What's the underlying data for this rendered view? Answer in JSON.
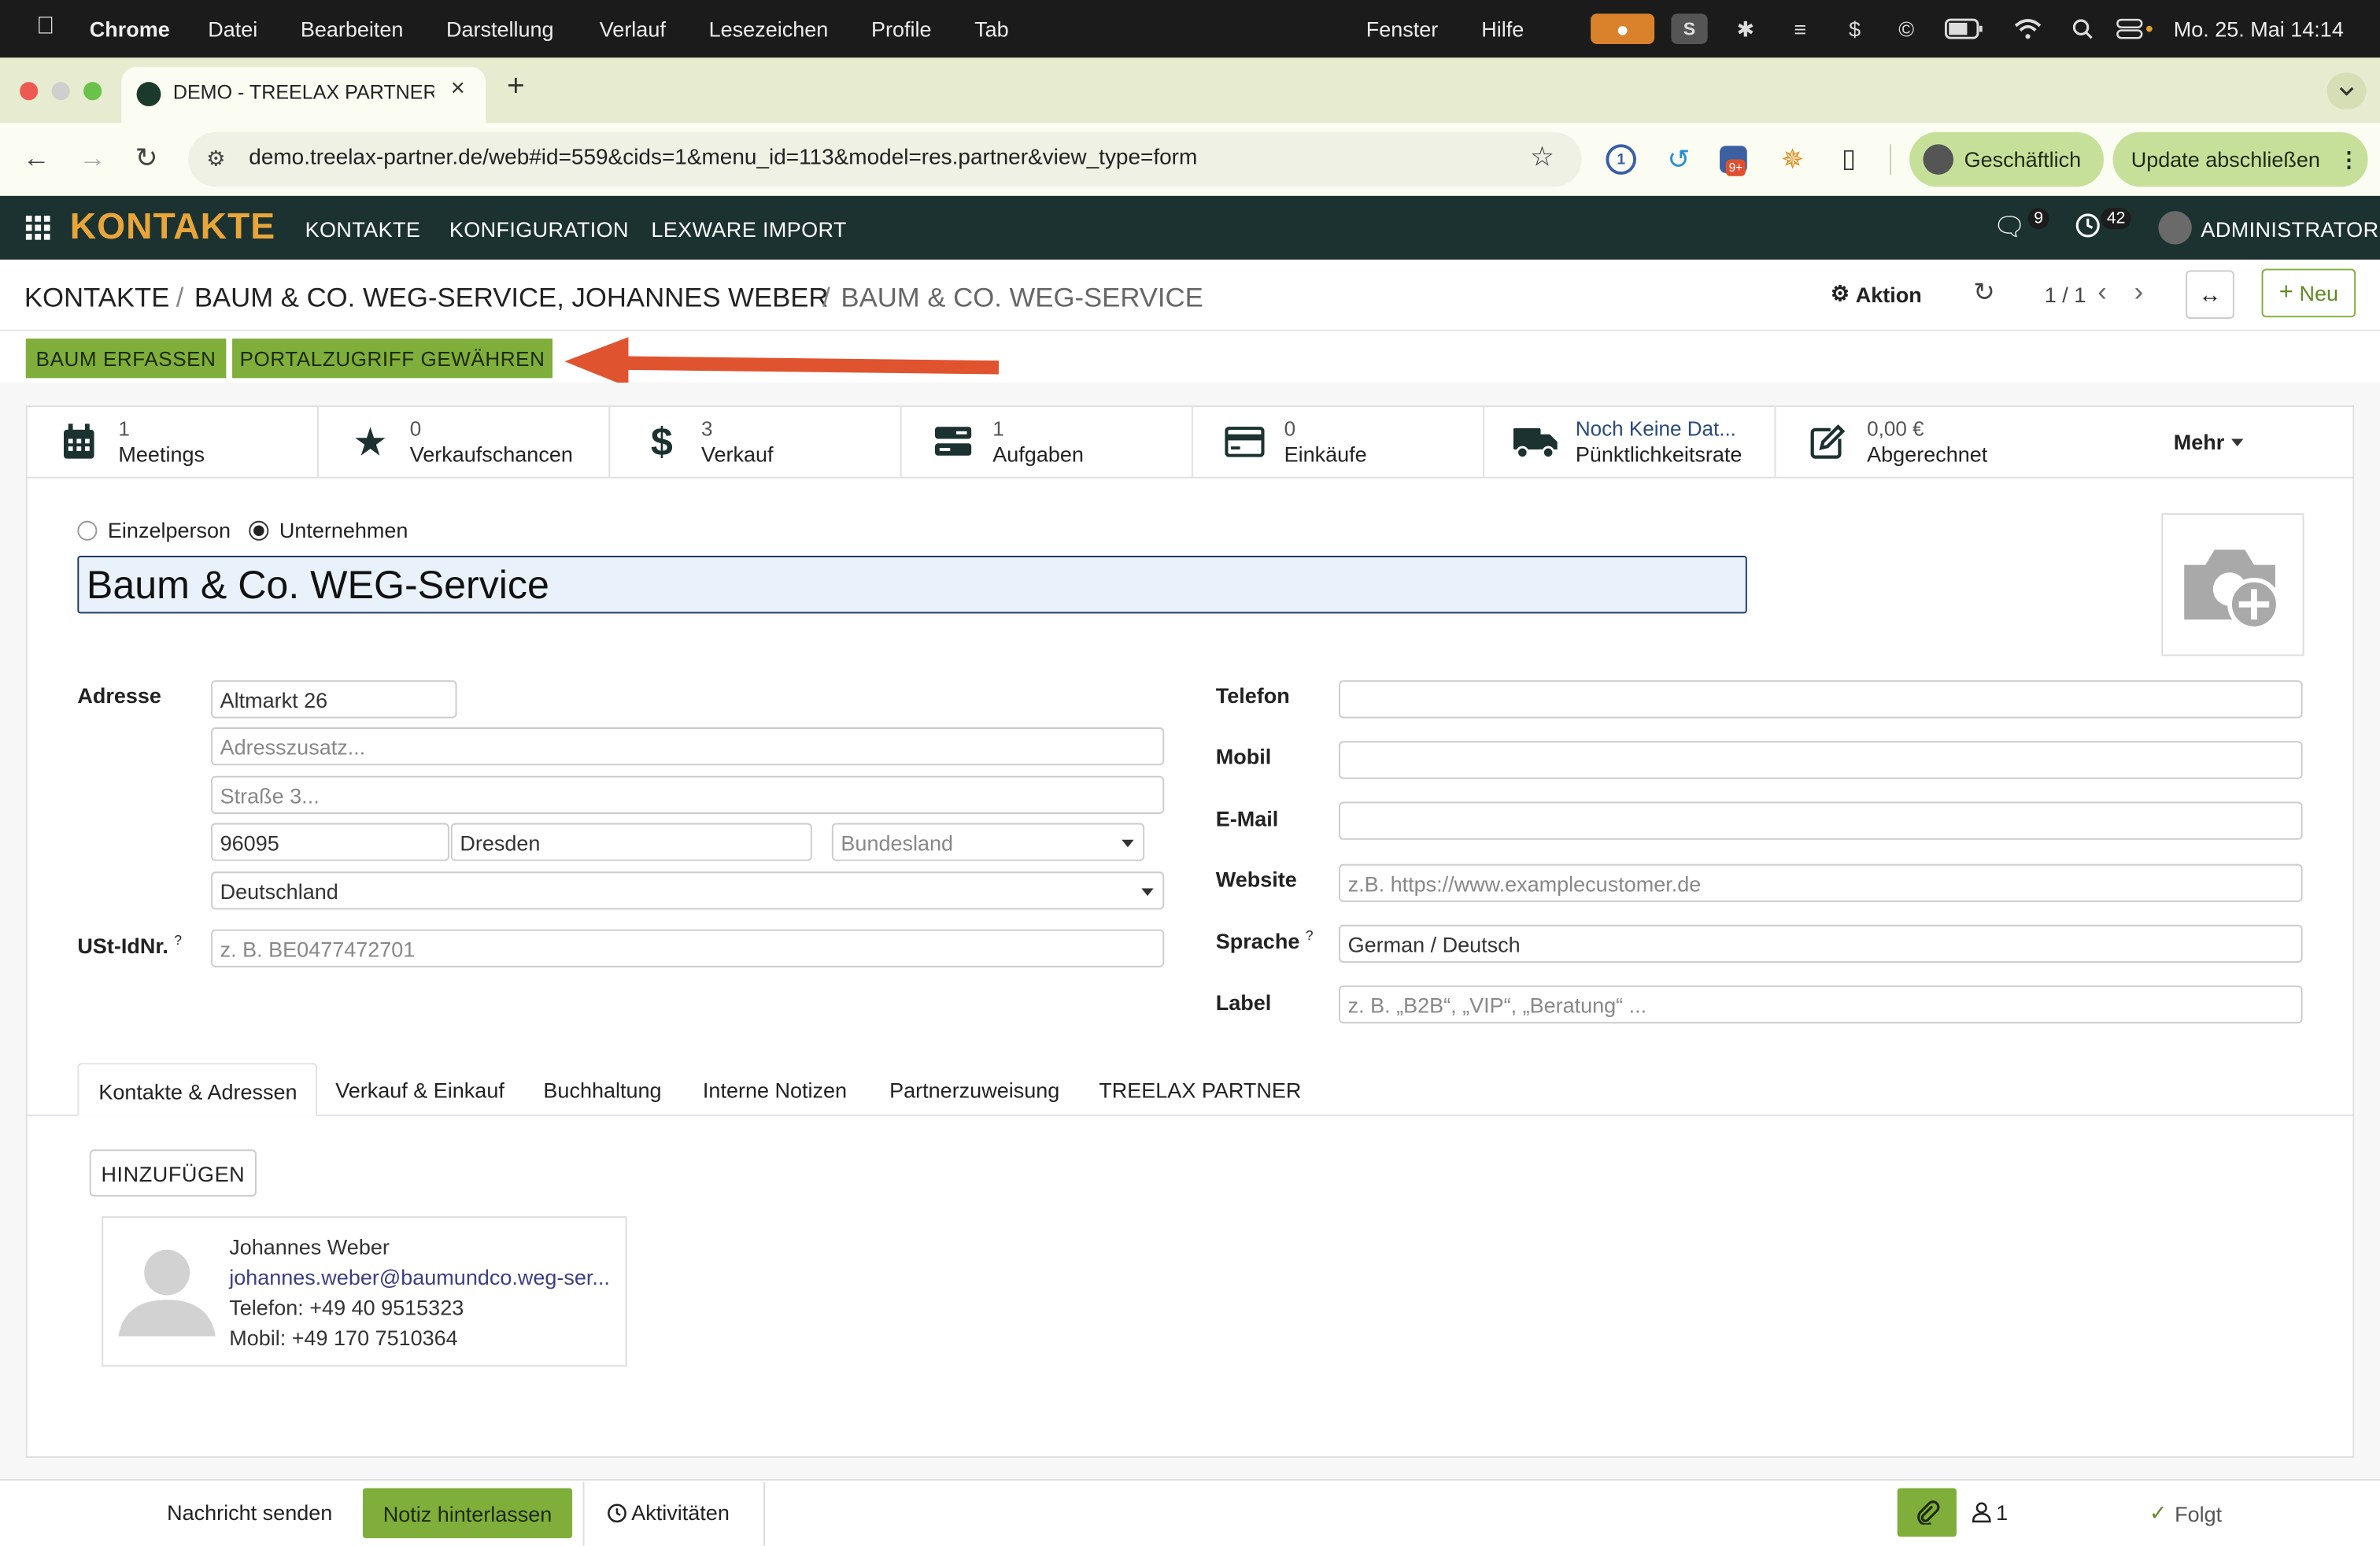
{
  "menubar": {
    "apple": "",
    "app": "Chrome",
    "items": [
      "Datei",
      "Bearbeiten",
      "Darstellung",
      "Verlauf",
      "Lesezeichen",
      "Profile",
      "Tab",
      "Fenster",
      "Hilfe"
    ],
    "datetime": "Mo. 25. Mai  14:14"
  },
  "browser": {
    "tab_title": "DEMO - TREELAX PARTNER -",
    "url": "demo.treelax-partner.de/web#id=559&cids=1&menu_id=113&model=res.partner&view_type=form",
    "profile_label": "Geschäftlich",
    "update_label": "Update abschließen",
    "ext_badge": "9+"
  },
  "odoo_nav": {
    "app_name": "KONTAKTE",
    "menu": [
      "KONTAKTE",
      "KONFIGURATION",
      "LEXWARE IMPORT"
    ],
    "messages_count": "9",
    "activities_count": "42",
    "user": "ADMINISTRATOR"
  },
  "breadcrumb": {
    "root": "KONTAKTE",
    "parent": "BAUM & CO. WEG-SERVICE, JOHANNES WEBER",
    "current": "BAUM & CO. WEG-SERVICE",
    "sep": "/"
  },
  "control": {
    "action_label": "Aktion",
    "pager": "1 / 1",
    "new_label": "Neu"
  },
  "header_buttons": {
    "baum": "BAUM ERFASSEN",
    "portal": "PORTALZUGRIFF GEWÄHREN"
  },
  "smart_buttons": [
    {
      "value": "1",
      "label": "Meetings",
      "icon": "calendar-icon"
    },
    {
      "value": "0",
      "label": "Verkaufschancen",
      "icon": "star-icon"
    },
    {
      "value": "3",
      "label": "Verkauf",
      "icon": "dollar-icon"
    },
    {
      "value": "1",
      "label": "Aufgaben",
      "icon": "tasks-icon"
    },
    {
      "value": "0",
      "label": "Einkäufe",
      "icon": "credit-card-icon"
    },
    {
      "value": "Noch Keine Dat...",
      "label": "Pünktlichkeitsrate",
      "icon": "truck-icon"
    },
    {
      "value": "0,00 €",
      "label": "Abgerechnet",
      "icon": "edit-icon"
    }
  ],
  "more_label": "Mehr",
  "form": {
    "type_person": "Einzelperson",
    "type_company": "Unternehmen",
    "name": "Baum & Co. WEG-Service",
    "address_label": "Adresse",
    "street": "Altmarkt 26",
    "street2_placeholder": "Adresszusatz...",
    "street3_placeholder": "Straße 3...",
    "zip": "96095",
    "city": "Dresden",
    "state_placeholder": "Bundesland",
    "country": "Deutschland",
    "vat_label": "USt-IdNr.",
    "vat_placeholder": "z. B. BE0477472701",
    "help_mark": "?",
    "phone_label": "Telefon",
    "mobile_label": "Mobil",
    "email_label": "E-Mail",
    "website_label": "Website",
    "website_placeholder": "z.B. https://www.examplecustomer.de",
    "lang_label": "Sprache",
    "lang_value": "German / Deutsch",
    "tag_label": "Label",
    "tag_placeholder": "z. B. „B2B“, „VIP“, „Beratung“ ..."
  },
  "notebook_tabs": [
    "Kontakte & Adressen",
    "Verkauf & Einkauf",
    "Buchhaltung",
    "Interne Notizen",
    "Partnerzuweisung",
    "TREELAX PARTNER"
  ],
  "contacts": {
    "add_label": "HINZUFÜGEN",
    "card": {
      "name": "Johannes Weber",
      "email": "johannes.weber@baumundco.weg-ser...",
      "phone": "Telefon: +49 40 9515323",
      "mobile": "Mobil: +49 170 7510364"
    }
  },
  "chatter": {
    "send": "Nachricht senden",
    "note": "Notiz hinterlassen",
    "activities": "Aktivitäten",
    "followers": "1",
    "following": "Folgt"
  },
  "colors": {
    "odoo_nav": "#1c3230",
    "accent_green": "#7fae3a",
    "app_name": "#e8a53a",
    "arrow": "#e0532f"
  }
}
